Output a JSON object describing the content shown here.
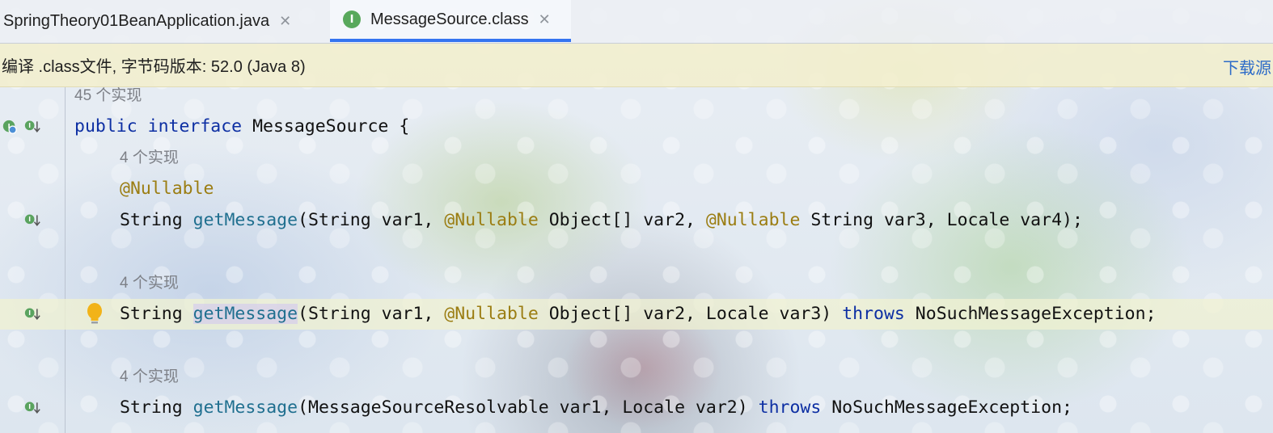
{
  "tabs": [
    {
      "label": "SpringTheory01BeanApplication.java",
      "active": false
    },
    {
      "label": "MessageSource.class",
      "active": true,
      "icon": "interface-icon",
      "icon_letter": "I"
    }
  ],
  "tab_close_glyph": "✕",
  "banner": {
    "message": "编译 .class文件, 字节码版本: 52.0 (Java 8)",
    "link": "下载源"
  },
  "code": {
    "interface_hint": "45 个实现",
    "decl": {
      "kw1": "public",
      "kw2": "interface",
      "name": "MessageSource",
      "brace": "{"
    },
    "method1": {
      "hint": "4 个实现",
      "annotation": "@Nullable",
      "type": "String",
      "name": "getMessage",
      "p1": "(String var1, ",
      "ann1": "@Nullable",
      "p2": " Object[] var2, ",
      "ann2": "@Nullable",
      "p3": " String var3, Locale var4);"
    },
    "method2": {
      "hint": "4 个实现",
      "type": "String",
      "name": "getMessage",
      "p1": "(String var1, ",
      "ann1": "@Nullable",
      "p2": " Object[] var2, Locale var3) ",
      "throws": "throws",
      "exception": " NoSuchMessageException;"
    },
    "method3": {
      "hint": "4 个实现",
      "type": "String",
      "name": "getMessage",
      "p1": "(MessageSourceResolvable var1, Locale var2) ",
      "throws": "throws",
      "exception": " NoSuchMessageException;"
    }
  },
  "colors": {
    "keyword": "#0d2fa3",
    "method": "#1f6f8f",
    "annotation": "#9b7d12",
    "hint": "#7d8087",
    "active_tab_underline": "#3574f0",
    "banner_bg": "#f2eece"
  },
  "gutter_icons": [
    "implemented-icon",
    "implementing-method-icon",
    "intention-bulb-icon"
  ]
}
